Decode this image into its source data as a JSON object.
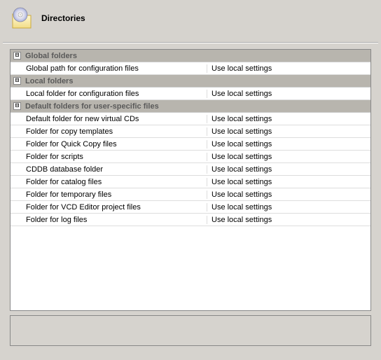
{
  "header": {
    "title": "Directories"
  },
  "expander_glyph": "⊟",
  "sections": [
    {
      "title": "Global folders",
      "rows": [
        {
          "label": "Global path for configuration files",
          "value": "Use local settings"
        }
      ]
    },
    {
      "title": "Local folders",
      "rows": [
        {
          "label": "Local folder for configuration files",
          "value": "Use local settings"
        }
      ]
    },
    {
      "title": "Default folders for user-specific files",
      "rows": [
        {
          "label": "Default folder for new virtual CDs",
          "value": "Use local settings"
        },
        {
          "label": "Folder for copy templates",
          "value": "Use local settings"
        },
        {
          "label": "Folder for Quick Copy files",
          "value": "Use local settings"
        },
        {
          "label": "Folder for scripts",
          "value": "Use local settings"
        },
        {
          "label": "CDDB database folder",
          "value": "Use local settings"
        },
        {
          "label": "Folder for catalog files",
          "value": "Use local settings"
        },
        {
          "label": "Folder for temporary files",
          "value": "Use local settings"
        },
        {
          "label": "Folder for VCD Editor project files",
          "value": "Use local settings"
        },
        {
          "label": "Folder for log files",
          "value": "Use local settings"
        }
      ]
    }
  ]
}
